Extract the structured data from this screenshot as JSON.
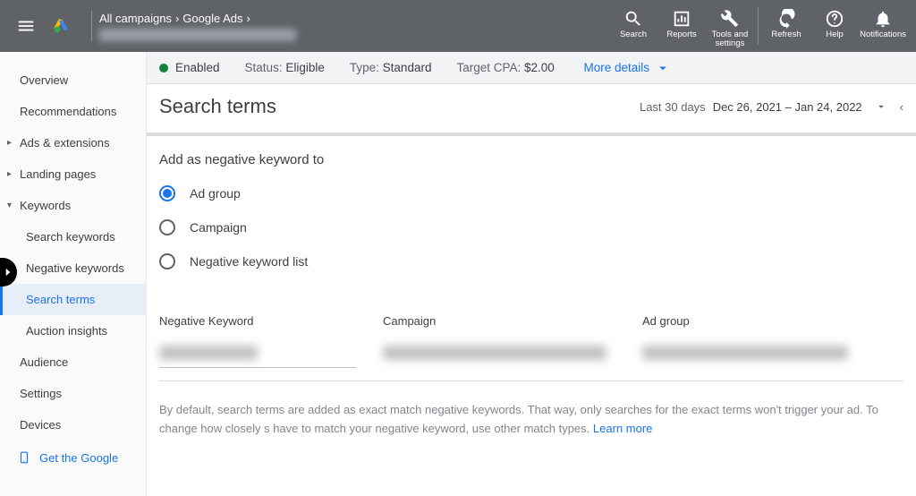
{
  "header": {
    "breadcrumb1": "All campaigns",
    "breadcrumb2": "Google Ads",
    "icons": {
      "search": "Search",
      "reports": "Reports",
      "tools": "Tools and settings",
      "refresh": "Refresh",
      "help": "Help",
      "notifications": "Notifications"
    }
  },
  "sidebar": {
    "overview": "Overview",
    "recommendations": "Recommendations",
    "ads_ext": "Ads & extensions",
    "landing": "Landing pages",
    "keywords": "Keywords",
    "search_keywords": "Search keywords",
    "negative_keywords": "Negative keywords",
    "search_terms": "Search terms",
    "auction_insights": "Auction insights",
    "audience": "Audience",
    "settings": "Settings",
    "devices": "Devices",
    "get_google": "Get the Google"
  },
  "status_bar": {
    "enabled": "Enabled",
    "status_lbl": "Status:",
    "status_val": "Eligible",
    "type_lbl": "Type:",
    "type_val": "Standard",
    "target_lbl": "Target CPA:",
    "target_val": "$2.00",
    "more": "More details"
  },
  "main": {
    "title": "Search terms",
    "last30": "Last 30 days",
    "date_range": "Dec 26, 2021 – Jan 24, 2022",
    "section_title": "Add as negative keyword to",
    "radio1": "Ad group",
    "radio2": "Campaign",
    "radio3": "Negative keyword list",
    "col_nk": "Negative Keyword",
    "col_camp": "Campaign",
    "col_ag": "Ad group",
    "footer1": "By default, search terms are added as exact match negative keywords. That way, only searches for the exact terms won't trigger your ad. To change how closely s",
    "footer2": "have to match your negative keyword, use other match types.",
    "learn": "Learn more"
  }
}
